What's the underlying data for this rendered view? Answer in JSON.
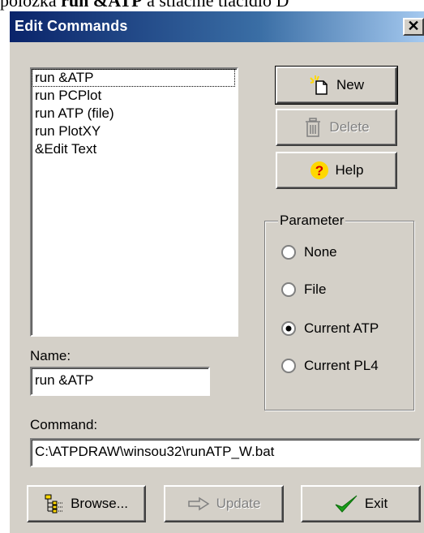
{
  "background_text": {
    "prefix": "položka ",
    "bold": "run &ATP",
    "suffix": " a stlačme tlačidlo D"
  },
  "window": {
    "title": "Edit Commands",
    "close_symbol": "✕"
  },
  "commands_list": {
    "items": [
      "run &ATP",
      "run PCPlot",
      "run ATP (file)",
      "run PlotXY",
      "&Edit Text"
    ],
    "selected_index": 0
  },
  "buttons": {
    "new_label": "New",
    "delete_label": "Delete",
    "help_label": "Help",
    "browse_label": "Browse...",
    "update_label": "Update",
    "exit_label": "Exit",
    "delete_enabled": false,
    "update_enabled": false
  },
  "parameter_group": {
    "title": "Parameter",
    "options": [
      "None",
      "File",
      "Current ATP",
      "Current PL4"
    ],
    "selected": "Current ATP"
  },
  "name_field": {
    "label": "Name:",
    "value": "run &ATP"
  },
  "command_field": {
    "label": "Command:",
    "value": "C:\\ATPDRAW\\winsou32\\runATP_W.bat"
  },
  "colors": {
    "title_gradient_start": "#0a246a",
    "title_gradient_end": "#a6caf0",
    "dialog_face": "#d4d0c8",
    "exit_check": "#1a9e1a",
    "help_icon": "#ffd800"
  },
  "icons": [
    "new-document-icon",
    "trash-icon",
    "help-question-icon",
    "folder-tree-icon",
    "arrow-right-icon",
    "checkmark-icon"
  ]
}
